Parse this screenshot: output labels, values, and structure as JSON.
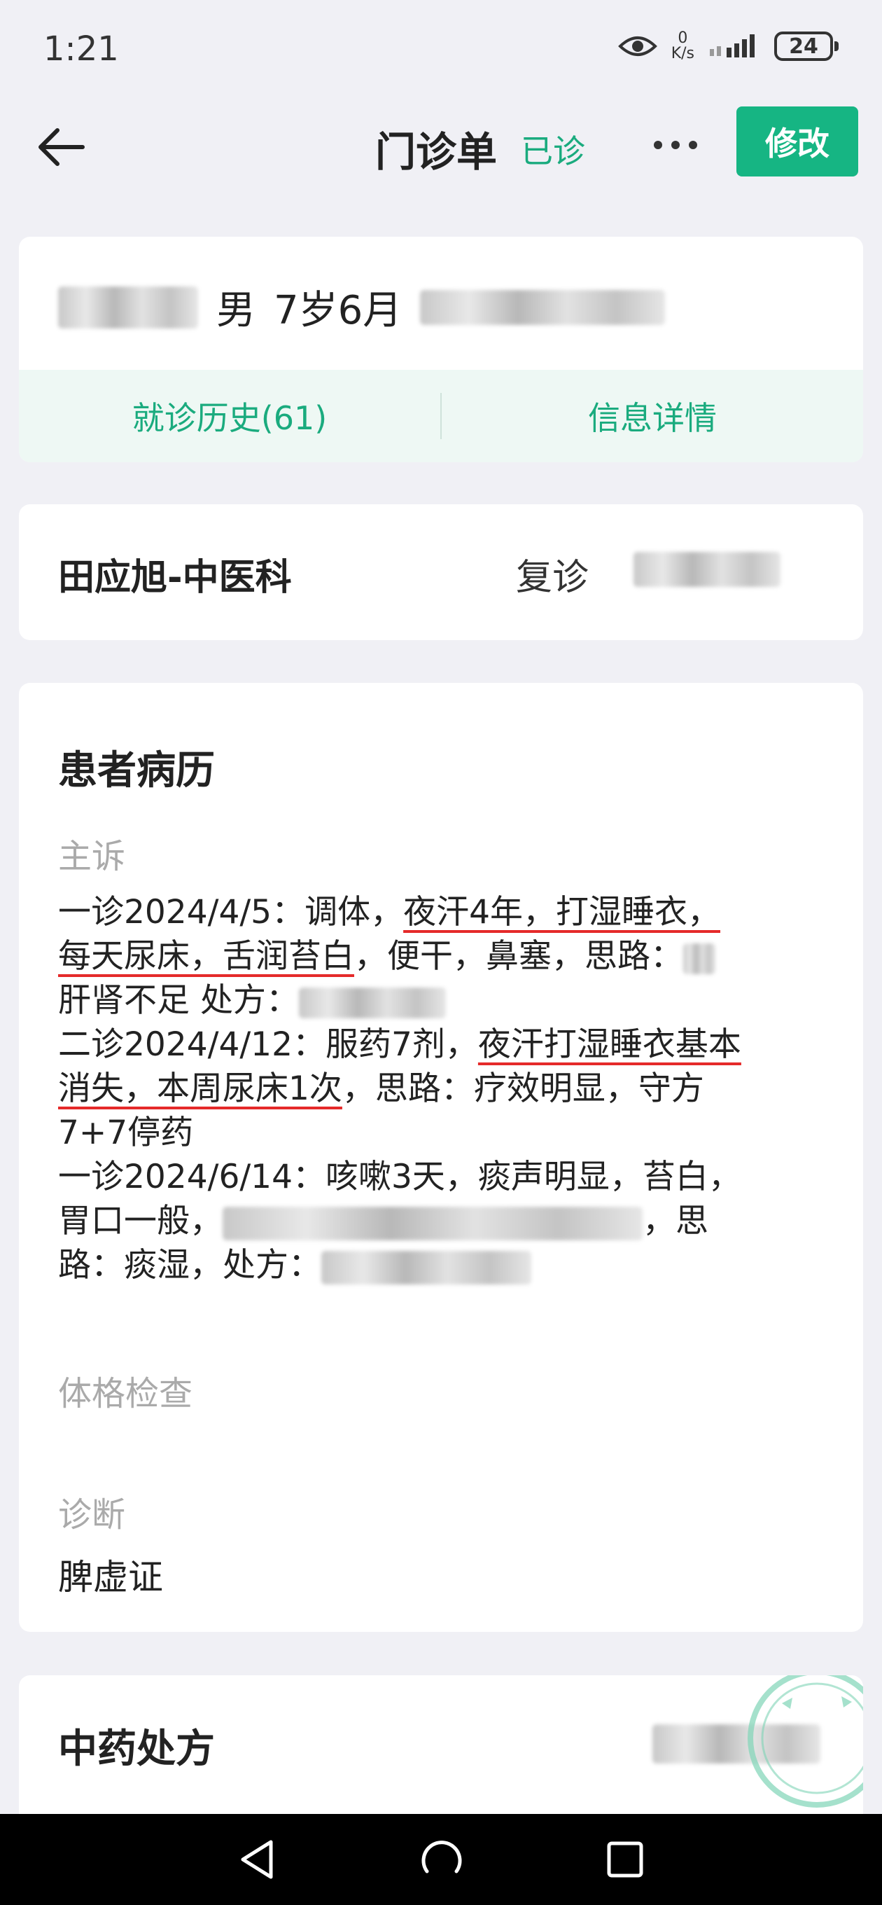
{
  "status_bar": {
    "time": "1:21",
    "net_speed_value": "0",
    "net_speed_unit": "K/s",
    "battery": "24"
  },
  "header": {
    "title": "门诊单",
    "status": "已诊",
    "edit_label": "修改"
  },
  "patient": {
    "gender": "男",
    "age": "7岁6月",
    "history_label": "就诊历史(61)",
    "info_label": "信息详情"
  },
  "visit": {
    "doctor": "田应旭-中医科",
    "visit_type": "复诊"
  },
  "record": {
    "title": "患者病历",
    "complaint_label": "主诉",
    "complaint_lines": {
      "l1_a": "一诊2024/4/5：调体，",
      "l1_u": "夜汗4年，打湿睡衣，",
      "l2_u": "每天尿床，舌润苔白",
      "l2_b": "，便干，鼻塞，思路：",
      "l3_a": "肝肾不足 处方：",
      "l4_a": "二诊2024/4/12：服药7剂，",
      "l4_u": "夜汗打湿睡衣基本",
      "l5_u": "消失，本周尿床1次",
      "l5_b": "，思路：疗效明显，守方",
      "l6_a": "7+7停药",
      "l7_a": "一诊2024/6/14：咳嗽3天，痰声明显，苔白，",
      "l8_a": "胃口一般，",
      "l8_b": "，思",
      "l9_a": "路：痰湿，处方："
    },
    "exam_label": "体格检查",
    "diagnosis_label": "诊断",
    "diagnosis_value": "脾虚证"
  },
  "herbal": {
    "title": "中药处方"
  },
  "colors": {
    "accent_green": "#16b583",
    "text_green": "#1aab7e",
    "underline_red": "#e52a2a",
    "page_bg": "#f0f0f5"
  },
  "icons": {
    "back": "arrow-left-icon",
    "more": "more-dots-icon",
    "eye": "eye-icon",
    "signal": "signal-icon",
    "stamp": "stamp-icon"
  }
}
